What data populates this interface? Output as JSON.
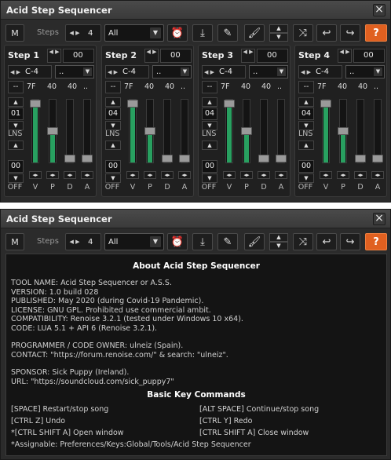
{
  "app": {
    "title": "Acid Step Sequencer",
    "close_label": "×"
  },
  "toolbar": {
    "m_label": "M",
    "steps_label": "Steps",
    "steps_value": "4",
    "dropdown_value": "All",
    "icons": [
      "clock-icon",
      "download-icon",
      "pencil-icon",
      "brush-icon",
      "updown-icon",
      "shuffle-icon",
      "undo-icon",
      "redo-icon",
      "help-icon"
    ],
    "help_label": "?",
    "arrow_lr": "◀ ▶",
    "caret": "▼"
  },
  "steps": [
    {
      "label": "Step 1",
      "num": "00",
      "note": "C-4",
      "instr": "..",
      "fx": "7F",
      "vel": "40",
      "off": "40",
      "zero": "..",
      "nudge_top": "01",
      "nudge_bot": "00",
      "v": 0.83,
      "p": 0.5,
      "d": 0.0,
      "a": 0.0
    },
    {
      "label": "Step 2",
      "num": "00",
      "note": "C-4",
      "instr": "..",
      "fx": "7F",
      "vel": "40",
      "off": "40",
      "zero": "..",
      "nudge_top": "04",
      "nudge_bot": "00",
      "v": 0.83,
      "p": 0.5,
      "d": 0.0,
      "a": 0.0
    },
    {
      "label": "Step 3",
      "num": "00",
      "note": "C-4",
      "instr": "..",
      "fx": "7F",
      "vel": "40",
      "off": "40",
      "zero": "..",
      "nudge_top": "04",
      "nudge_bot": "00",
      "v": 0.83,
      "p": 0.5,
      "d": 0.0,
      "a": 0.0
    },
    {
      "label": "Step 4",
      "num": "00",
      "note": "C-4",
      "instr": "..",
      "fx": "7F",
      "vel": "40",
      "off": "40",
      "zero": "..",
      "nudge_top": "04",
      "nudge_bot": "00",
      "v": 0.83,
      "p": 0.5,
      "d": 0.0,
      "a": 0.0
    }
  ],
  "step_labels": {
    "dash": "--",
    "lns": "LNS",
    "off": "OFF",
    "v": "V",
    "p": "P",
    "d": "D",
    "a": "A"
  },
  "about": {
    "heading": "About Acid Step Sequencer",
    "lines1": [
      "TOOL NAME: Acid Step Sequencer or A.S.S.",
      "VERSION: 1.0 build 028",
      "PUBLISHED: May 2020 (during Covid-19 Pandemic).",
      "LICENSE: GNU GPL. Prohibited use commercial ambit.",
      "COMPATIBILITY: Renoise 3.2.1 (tested under Windows 10 x64).",
      "CODE: LUA 5.1 + API 6 (Renoise 3.2.1)."
    ],
    "lines2": [
      "PROGRAMMER / CODE OWNER: ulneiz (Spain).",
      "CONTACT: \"https://forum.renoise.com/\" & search: \"ulneiz\"."
    ],
    "lines3": [
      "SPONSOR: Sick Puppy (Ireland).",
      "URL: \"https://soundcloud.com/sick_puppy7\""
    ],
    "keys_heading": "Basic Key Commands",
    "keys": [
      "[SPACE] Restart/stop song",
      "[ALT SPACE] Continue/stop song",
      "[CTRL Z] Undo",
      "[CTRL Y] Redo",
      "*[CTRL SHIFT A] Open window",
      "[CTRL SHIFT A] Close window"
    ],
    "assignable": "*Assignable: Preferences/Keys:Global/Tools/Acid Step Sequencer"
  },
  "colors": {
    "accent_green": "#28a060",
    "help_orange": "#e06020",
    "bg": "#2b2b2b"
  }
}
